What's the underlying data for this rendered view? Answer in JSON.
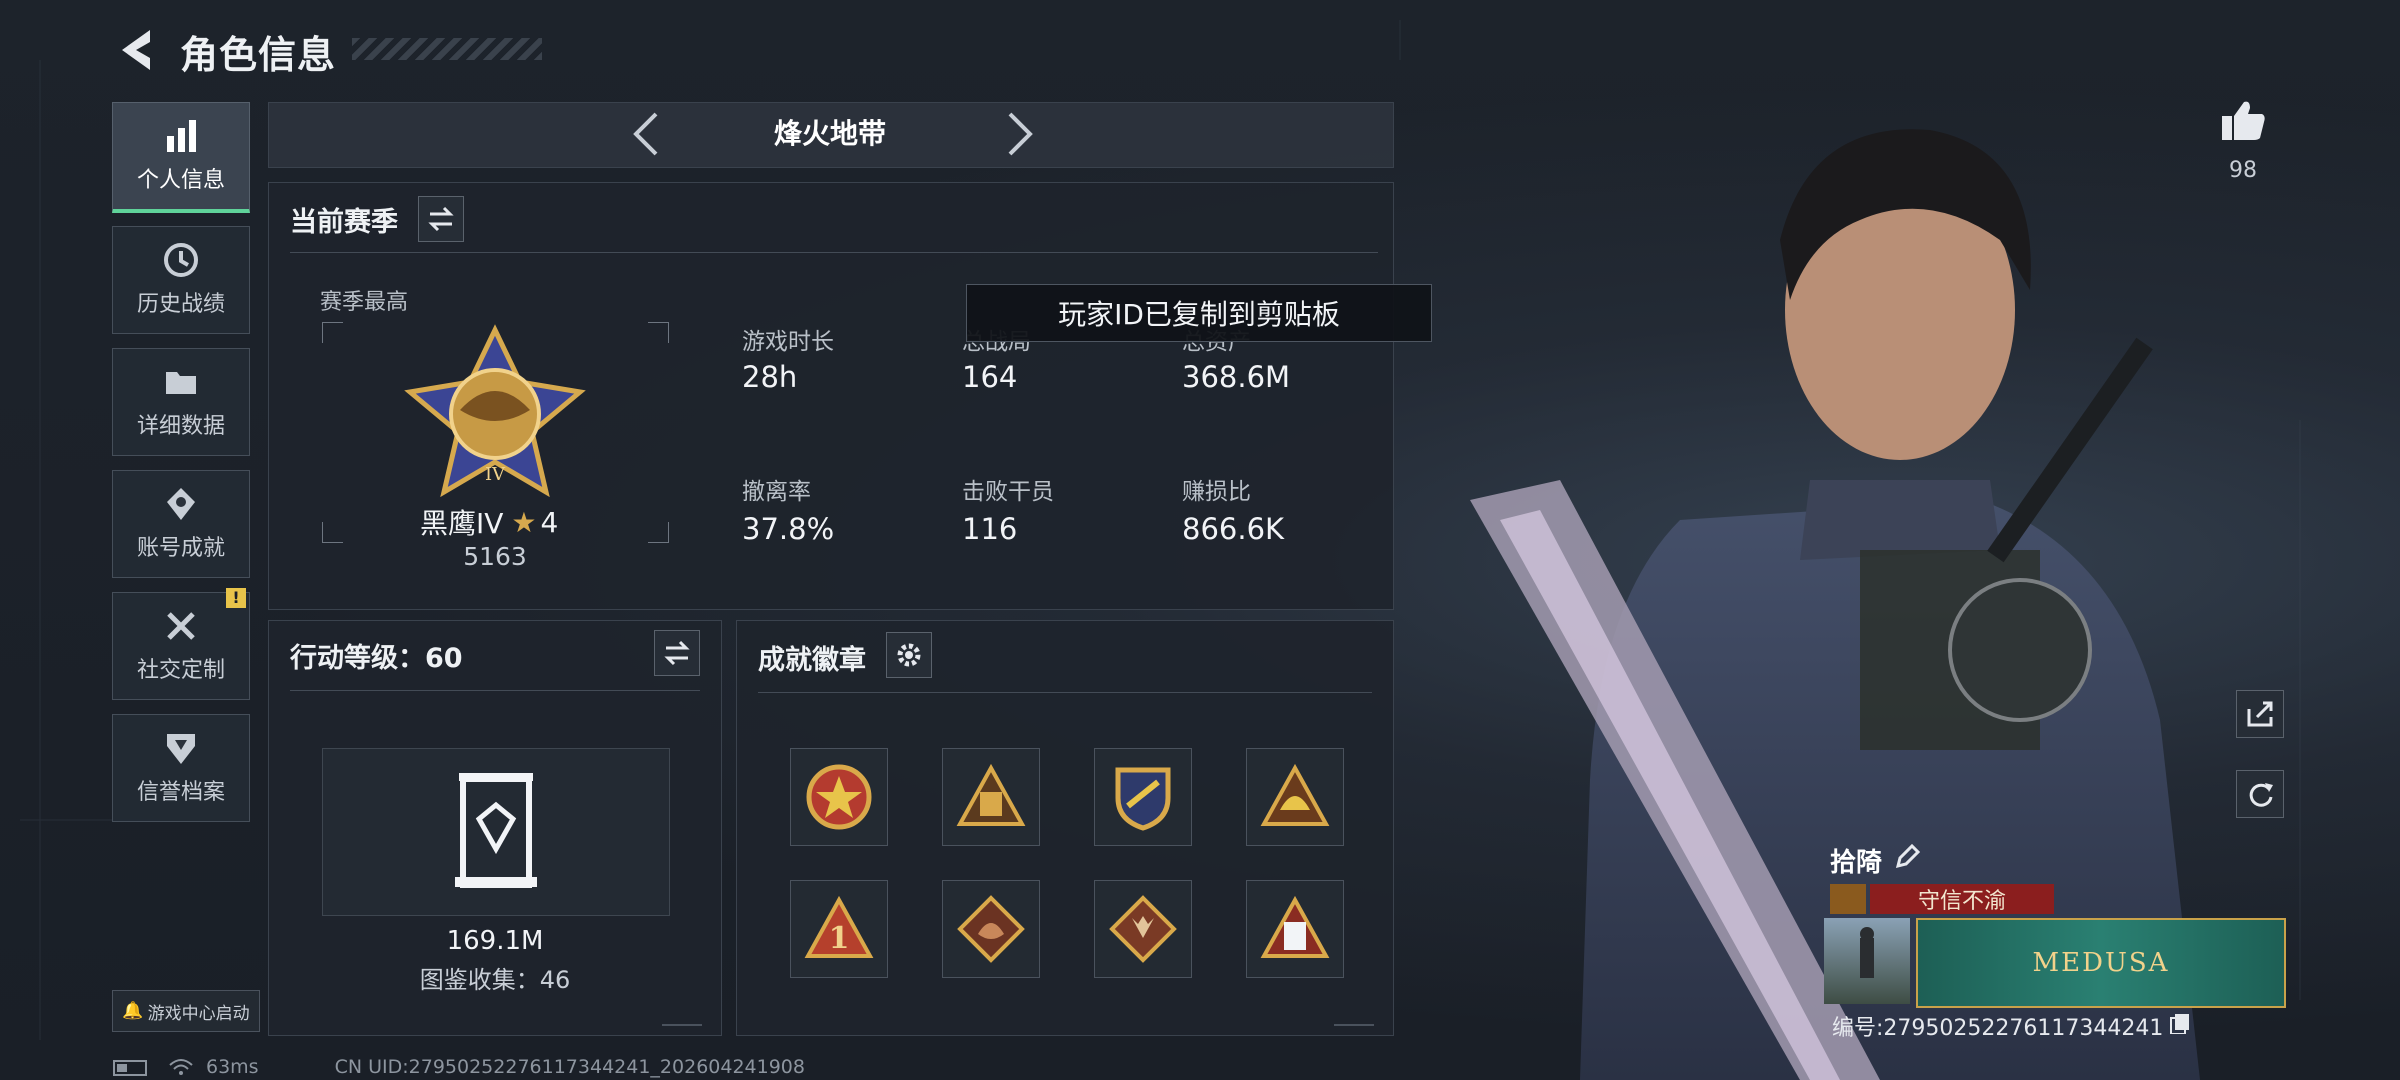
{
  "header": {
    "title": "角色信息"
  },
  "sidebar": {
    "items": [
      {
        "label": "个人信息",
        "icon": "bar-chart-icon"
      },
      {
        "label": "历史战绩",
        "icon": "history-icon"
      },
      {
        "label": "详细数据",
        "icon": "folder-icon"
      },
      {
        "label": "账号成就",
        "icon": "achievement-icon"
      },
      {
        "label": "社交定制",
        "icon": "tools-icon"
      },
      {
        "label": "信誉档案",
        "icon": "credit-icon"
      }
    ],
    "game_center": "游戏中心启动"
  },
  "mode_selector": {
    "label": "烽火地带"
  },
  "season": {
    "title": "当前赛季",
    "best_label": "赛季最高",
    "rank_name": "黑鹰IV",
    "rank_stars": "4",
    "rank_score": "5163",
    "stats": [
      {
        "label": "游戏时长",
        "value": "28h"
      },
      {
        "label": "总战局",
        "value": "164"
      },
      {
        "label": "总资产",
        "value": "368.6M"
      },
      {
        "label": "撤离率",
        "value": "37.8%"
      },
      {
        "label": "击败干员",
        "value": "116"
      },
      {
        "label": "赚损比",
        "value": "866.6K"
      }
    ]
  },
  "toast": {
    "text": "玩家ID已复制到剪贴板"
  },
  "action_level": {
    "title": "行动等级：60",
    "value": "169.1M",
    "collection": "图鉴收集：46"
  },
  "badges": {
    "title": "成就徽章",
    "items": [
      "star-badge-icon",
      "bag-badge-icon",
      "shield-badge-icon",
      "helmet-badge-icon",
      "rank-one-badge-icon",
      "dragon-badge-icon",
      "wolf-badge-icon",
      "card-badge-icon"
    ]
  },
  "likes": {
    "count": "98"
  },
  "player": {
    "name": "拾陭",
    "title": "守信不渝",
    "card_text": "MEDUSA",
    "id_label": "编号:279502522761173442​41"
  },
  "status_bar": {
    "ping": "63ms",
    "uid": "CN UID:27950252276117344241_202604241908"
  },
  "colors": {
    "accent_green": "#5fd39a",
    "title_red": "#8b1e1e",
    "warning_yellow": "#e8c44a"
  }
}
